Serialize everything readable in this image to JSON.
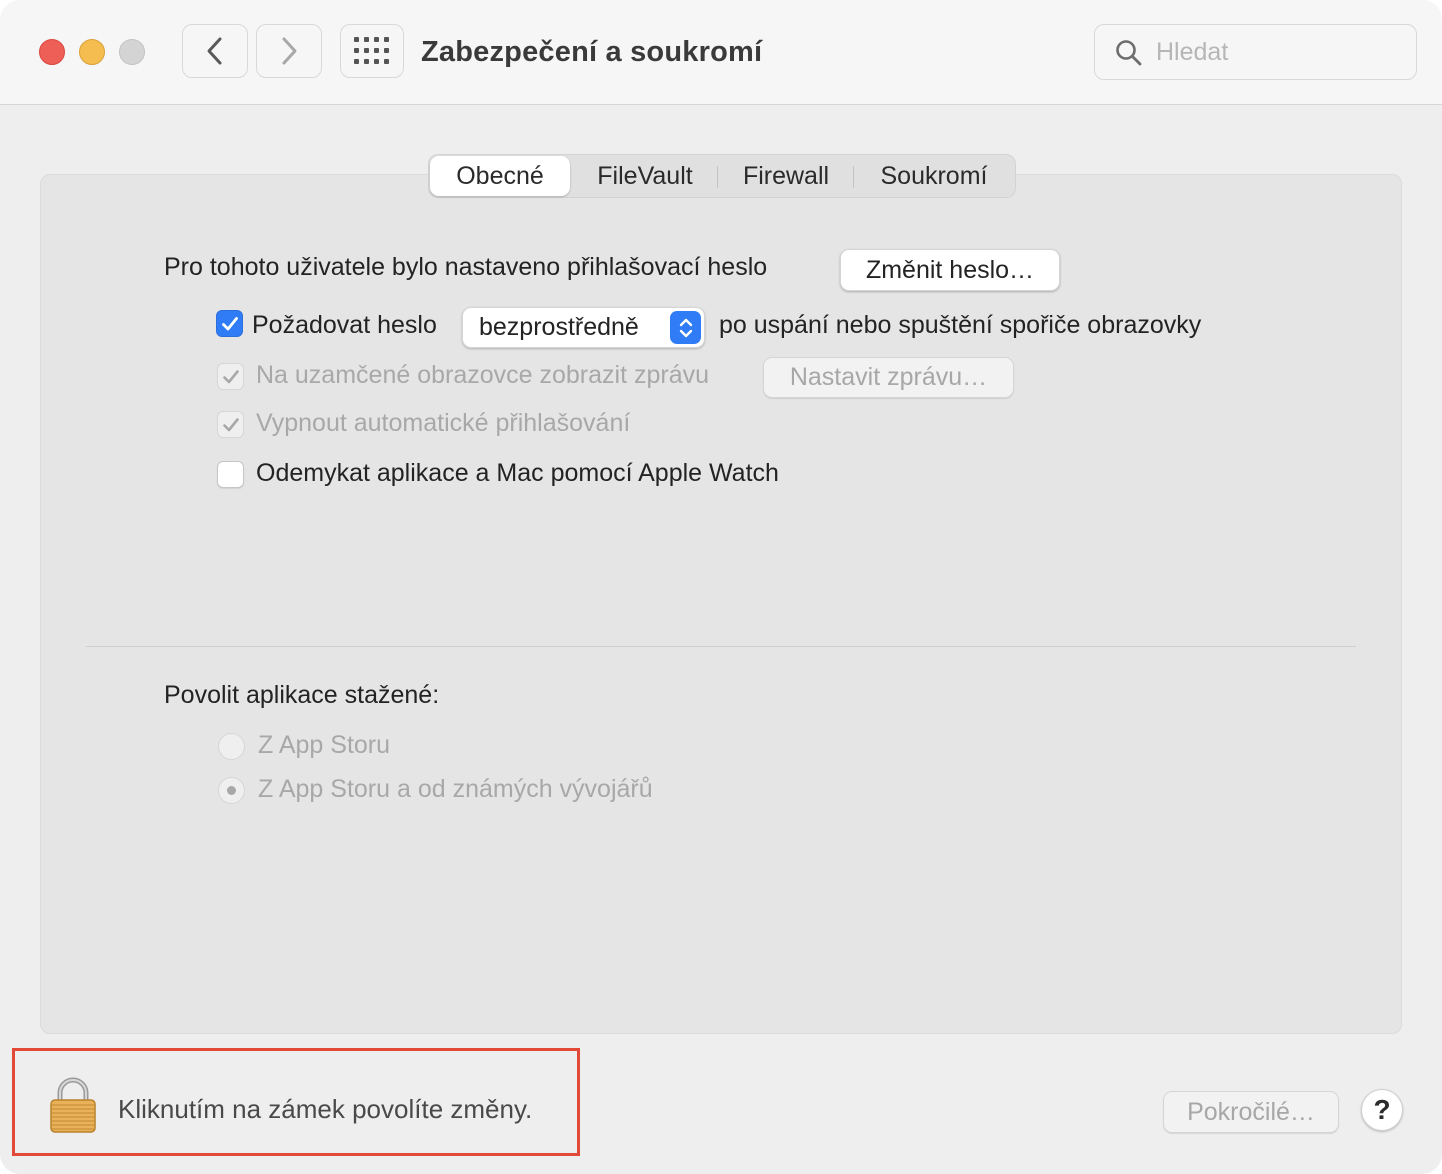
{
  "window": {
    "title": "Zabezpečení a soukromí",
    "search_placeholder": "Hledat"
  },
  "tabs": [
    {
      "label": "Obecné",
      "active": true
    },
    {
      "label": "FileVault",
      "active": false
    },
    {
      "label": "Firewall",
      "active": false
    },
    {
      "label": "Soukromí",
      "active": false
    }
  ],
  "general": {
    "password_text": "Pro tohoto uživatele bylo nastaveno přihlašovací heslo",
    "change_password_button": "Změnit heslo…",
    "require_password": {
      "label": "Požadovat heslo",
      "checked": true,
      "select_value": "bezprostředně",
      "suffix": "po uspání nebo spuštění spořiče obrazovky"
    },
    "lock_message": {
      "label": "Na uzamčené obrazovce zobrazit zprávu",
      "checked": true,
      "enabled": false,
      "button": "Nastavit zprávu…"
    },
    "disable_auto_login": {
      "label": "Vypnout automatické přihlašování",
      "checked": true,
      "enabled": false
    },
    "apple_watch": {
      "label": "Odemykat aplikace a Mac pomocí Apple Watch",
      "checked": false
    }
  },
  "downloads": {
    "heading": "Povolit aplikace stažené:",
    "options": [
      {
        "label": "Z App Storu",
        "selected": false
      },
      {
        "label": "Z App Storu a od známých vývojářů",
        "selected": true
      }
    ]
  },
  "footer": {
    "lock_text": "Kliknutím na zámek povolíte změny.",
    "advanced_button": "Pokročilé…",
    "help_button": "?"
  },
  "colors": {
    "accent": "#2f7cf6",
    "close": "#ed5f57",
    "minimize": "#f5bd4f",
    "highlight": "#e24a37"
  }
}
